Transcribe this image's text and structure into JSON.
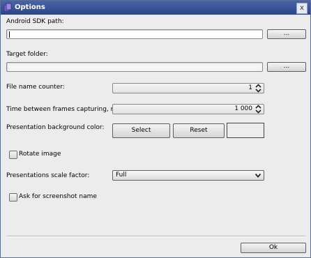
{
  "window": {
    "title": "Options",
    "close_glyph": "x"
  },
  "fields": {
    "sdk_path": {
      "label": "Android SDK path:",
      "value": "",
      "browse_label": "..."
    },
    "target_folder": {
      "label": "Target folder:",
      "value": "",
      "browse_label": "..."
    },
    "file_name_counter": {
      "label": "File name counter:",
      "value": "1"
    },
    "frame_interval": {
      "label": "Time between frames capturing, ms:",
      "value": "1 000"
    },
    "background_color": {
      "label": "Presentation background color:",
      "select_label": "Select",
      "reset_label": "Reset",
      "color": "#ececec"
    },
    "rotate_image": {
      "label": "Rotate image",
      "checked": false
    },
    "scale_factor": {
      "label": "Presentations scale factor:",
      "value": "Full"
    },
    "ask_screenshot_name": {
      "label": "Ask for screenshot name",
      "checked": false
    }
  },
  "footer": {
    "ok_label": "Ok"
  }
}
